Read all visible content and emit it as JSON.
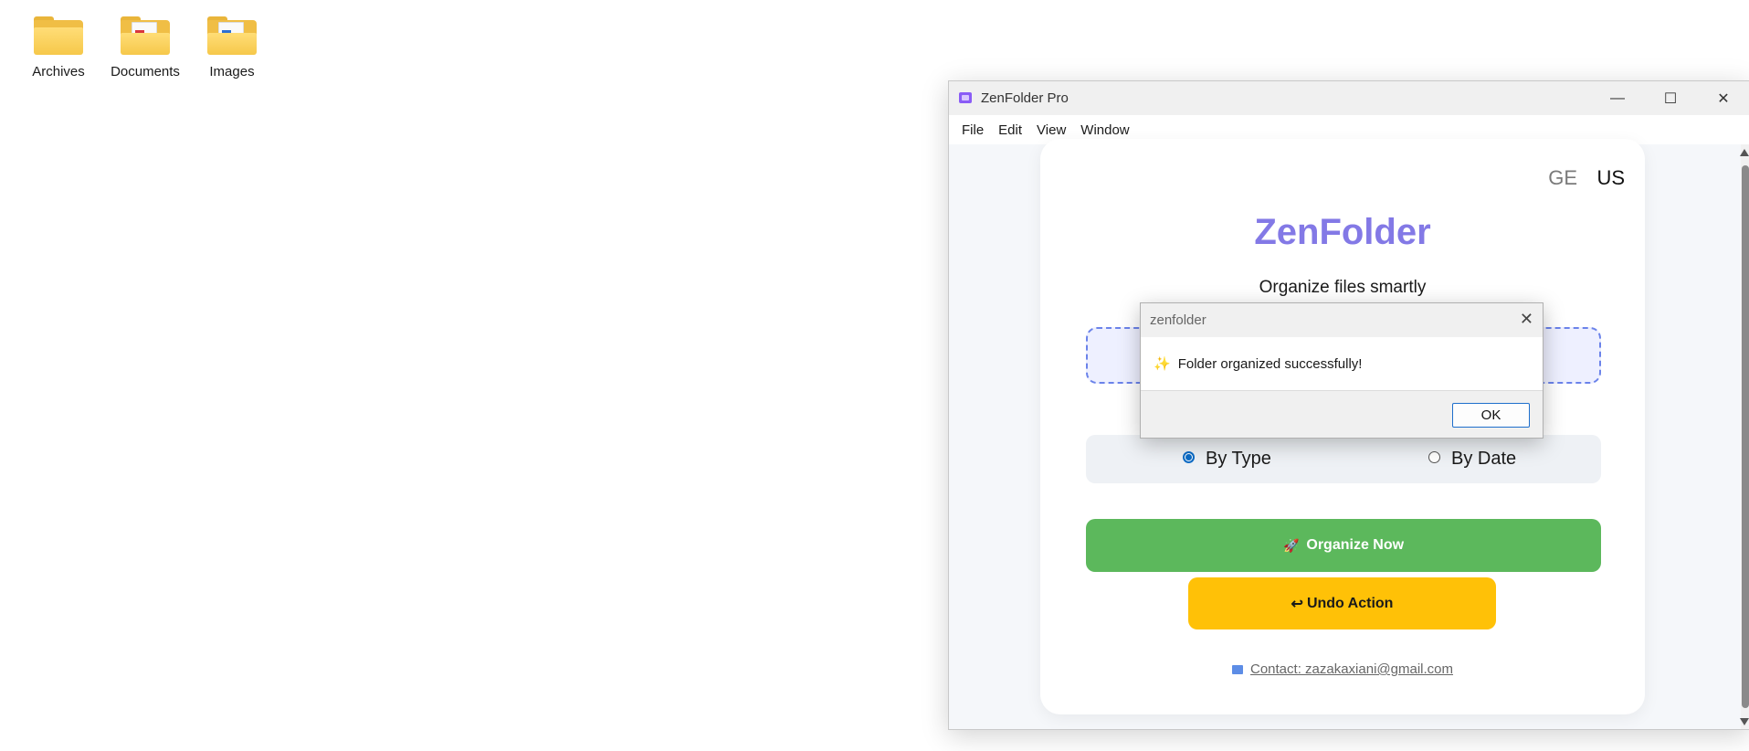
{
  "desktop": {
    "icons": [
      {
        "label": "Archives",
        "icon": "folder-icon"
      },
      {
        "label": "Documents",
        "icon": "folder-documents-icon"
      },
      {
        "label": "Images",
        "icon": "folder-images-icon"
      }
    ]
  },
  "window": {
    "title": "ZenFolder Pro",
    "controls": {
      "minimize": "—",
      "maximize": "☐",
      "close": "✕"
    },
    "menu": [
      "File",
      "Edit",
      "View",
      "Window"
    ]
  },
  "app": {
    "languages": {
      "ge": "GE",
      "us": "US"
    },
    "brand": "ZenFolder",
    "tagline": "Organize files smartly",
    "sort_options": [
      {
        "label": "By Type",
        "checked": true
      },
      {
        "label": "By Date",
        "checked": false
      }
    ],
    "organize_button": {
      "icon": "🚀",
      "label": "Organize Now"
    },
    "undo_button": {
      "icon": "↩",
      "label": "Undo Action"
    },
    "contact": "Contact: zazakaxiani@gmail.com"
  },
  "dialog": {
    "title": "zenfolder",
    "icon": "✨",
    "message": "Folder organized successfully!",
    "ok_label": "OK",
    "close": "✕"
  },
  "colors": {
    "brand": "#8379e6",
    "organize": "#5cb85c",
    "undo": "#ffc107",
    "dropzone_border": "#6b83ea"
  }
}
